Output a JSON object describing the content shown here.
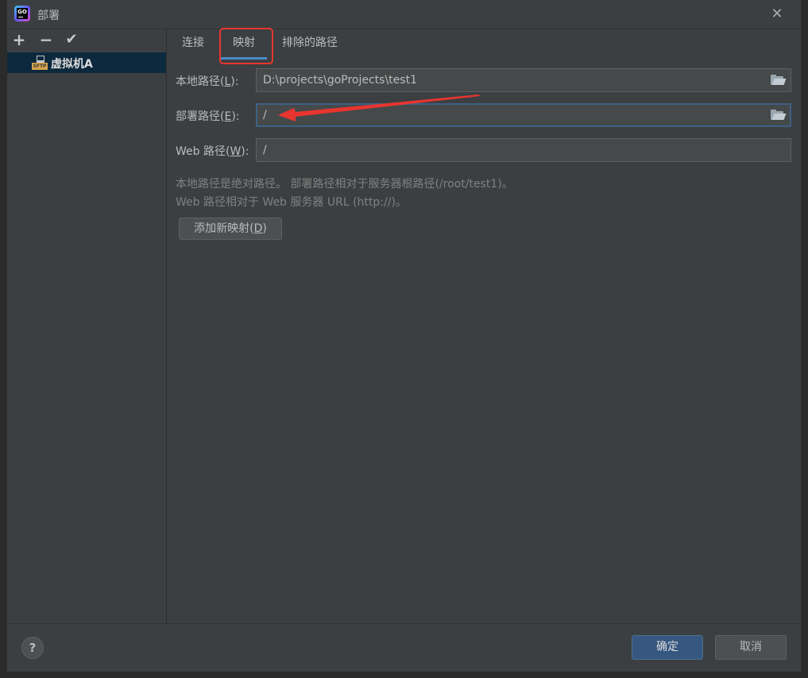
{
  "window": {
    "title": "部署"
  },
  "app_icon": {
    "name": "goland-icon",
    "text": "GO"
  },
  "sidebar": {
    "toolbar": {
      "add": "+",
      "remove": "−",
      "check": "✔"
    },
    "server": {
      "label": "虚拟机A",
      "icon_text": "SFTP"
    }
  },
  "tabs": [
    {
      "label": "连接"
    },
    {
      "label": "映射"
    },
    {
      "label": "排除的路径"
    }
  ],
  "form": {
    "local_path": {
      "label_pre": "本地路径(",
      "mnemonic": "L",
      "label_post": "):",
      "value": "D:\\projects\\goProjects\\test1"
    },
    "deploy_path": {
      "label_pre": "部署路径(",
      "mnemonic": "E",
      "label_post": "):",
      "value": "/"
    },
    "web_path": {
      "label_pre": "Web 路径(",
      "mnemonic": "W",
      "label_post": "):",
      "value": "/"
    }
  },
  "hints": {
    "line1": "本地路径是绝对路径。 部署路径相对于服务器根路径(/root/test1)。",
    "line2": "Web 路径相对于 Web 服务器 URL (http://)。"
  },
  "add_mapping": {
    "label_pre": "添加新映射(",
    "mnemonic": "D",
    "label_post": ")"
  },
  "footer": {
    "help": "?",
    "ok": "确定",
    "cancel": "取消"
  },
  "colors": {
    "accent": "#4a88c7",
    "annotation": "#e8352f",
    "primary_button": "#365880"
  }
}
